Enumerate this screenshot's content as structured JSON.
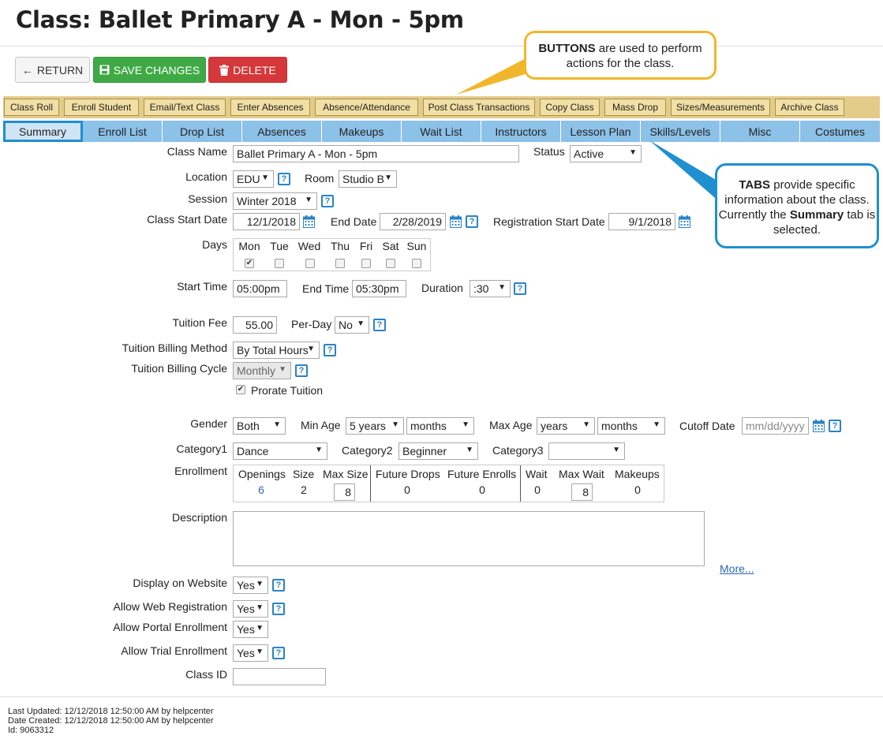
{
  "page": {
    "title": "Class: Ballet Primary A - Mon - 5pm"
  },
  "buttons": {
    "return": "RETURN",
    "save": "SAVE CHANGES",
    "delete": "DELETE"
  },
  "toolbar": [
    "Class Roll",
    "Enroll Student",
    "Email/Text Class",
    "Enter Absences",
    "Absence/Attendance",
    "Post Class Transactions",
    "Copy Class",
    "Mass Drop",
    "Sizes/Measurements",
    "Archive Class"
  ],
  "tabs": [
    "Summary",
    "Enroll List",
    "Drop List",
    "Absences",
    "Makeups",
    "Wait List",
    "Instructors",
    "Lesson Plan",
    "Skills/Levels",
    "Misc",
    "Costumes"
  ],
  "active_tab": "Summary",
  "form": {
    "class_name": {
      "label": "Class Name",
      "value": "Ballet Primary A - Mon - 5pm"
    },
    "status": {
      "label": "Status",
      "value": "Active"
    },
    "location": {
      "label": "Location",
      "value": "EDU"
    },
    "room": {
      "label": "Room",
      "value": "Studio B"
    },
    "session": {
      "label": "Session",
      "value": "Winter 2018"
    },
    "class_start_date": {
      "label": "Class Start Date",
      "value": "12/1/2018"
    },
    "end_date": {
      "label": "End Date",
      "value": "2/28/2019"
    },
    "registration_start_date": {
      "label": "Registration Start Date",
      "value": "9/1/2018"
    },
    "days": {
      "label": "Days",
      "items": [
        {
          "name": "Mon",
          "checked": true
        },
        {
          "name": "Tue",
          "checked": false
        },
        {
          "name": "Wed",
          "checked": false
        },
        {
          "name": "Thu",
          "checked": false
        },
        {
          "name": "Fri",
          "checked": false
        },
        {
          "name": "Sat",
          "checked": false
        },
        {
          "name": "Sun",
          "checked": false
        }
      ]
    },
    "start_time": {
      "label": "Start Time",
      "value": "05:00pm"
    },
    "end_time": {
      "label": "End Time",
      "value": "05:30pm"
    },
    "duration": {
      "label": "Duration",
      "value": ":30"
    },
    "tuition_fee": {
      "label": "Tuition Fee",
      "value": "55.00"
    },
    "per_day": {
      "label": "Per-Day",
      "value": "No"
    },
    "billing_method": {
      "label": "Tuition Billing Method",
      "value": "By Total Hours"
    },
    "billing_cycle": {
      "label": "Tuition Billing Cycle",
      "value": "Monthly"
    },
    "prorate": {
      "label": "Prorate Tuition",
      "checked": true
    },
    "gender": {
      "label": "Gender",
      "value": "Both"
    },
    "min_age": {
      "label": "Min Age",
      "years": "5 years",
      "months": "months"
    },
    "max_age": {
      "label": "Max Age",
      "years": "years",
      "months": "months"
    },
    "cutoff_date": {
      "label": "Cutoff Date",
      "placeholder": "mm/dd/yyyy"
    },
    "category1": {
      "label": "Category1",
      "value": "Dance"
    },
    "category2": {
      "label": "Category2",
      "value": "Beginner"
    },
    "category3": {
      "label": "Category3",
      "value": ""
    },
    "enrollment": {
      "label": "Enrollment",
      "headers": [
        "Openings",
        "Size",
        "Max Size",
        "Future Drops",
        "Future Enrolls",
        "Wait",
        "Max Wait",
        "Makeups"
      ],
      "values": {
        "openings": "6",
        "size": "2",
        "max_size": "8",
        "future_drops": "0",
        "future_enrolls": "0",
        "wait": "0",
        "max_wait": "8",
        "makeups": "0"
      }
    },
    "description": {
      "label": "Description",
      "more": "More..."
    },
    "display_on_website": {
      "label": "Display on Website",
      "value": "Yes"
    },
    "allow_web_registration": {
      "label": "Allow Web Registration",
      "value": "Yes"
    },
    "allow_portal_enrollment": {
      "label": "Allow Portal Enrollment",
      "value": "Yes"
    },
    "allow_trial_enrollment": {
      "label": "Allow Trial Enrollment",
      "value": "Yes"
    },
    "class_id": {
      "label": "Class ID",
      "value": ""
    }
  },
  "footer": {
    "last_updated": "Last Updated: 12/12/2018 12:50:00 AM by helpcenter",
    "date_created": "Date Created: 12/12/2018 12:50:00 AM by helpcenter",
    "id": "Id: 9063312"
  },
  "callouts": {
    "buttons": {
      "bold": "BUTTONS",
      "text": " are used to perform actions for the class."
    },
    "tabs": {
      "bold": "TABS",
      "text1": " provide specific information about the class. Currently the ",
      "bold2": "Summary",
      "text2": " tab is selected."
    }
  },
  "colors": {
    "save": "#3faa45",
    "delete": "#d6373a",
    "toolbar": "#e3cc8a",
    "tabs": "#8cc1e8",
    "active_tab_border": "#1f8fd0",
    "callout_buttons": "#f1b72c",
    "callout_tabs": "#1f8fd0"
  }
}
